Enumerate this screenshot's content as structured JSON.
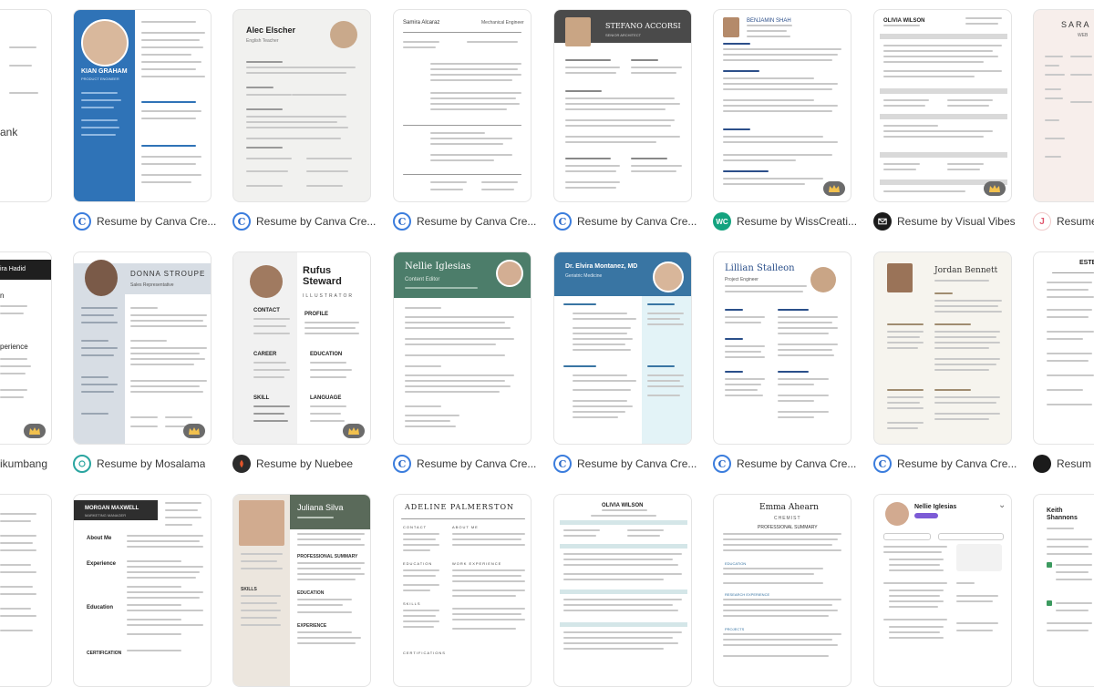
{
  "row1": {
    "cards": [
      {
        "name": "KIAN GRAHAM",
        "subtitle": "PRODUCT ENGINEER"
      },
      {
        "name": "Alec Elscher",
        "subtitle": "English Teacher"
      },
      {
        "name": "Samira Alcaraz",
        "subtitle": "Mechanical Engineer"
      },
      {
        "name": "STEFANO ACCORSI",
        "subtitle": "SENIOR ARCHITECT"
      },
      {
        "name": "BENJAMIN SHAH"
      },
      {
        "name": "OLIVIA WILSON"
      },
      {
        "name": "SARA",
        "subtitle": "WEB"
      }
    ],
    "captions": [
      {
        "text": "ank"
      },
      {
        "text": "Resume by Canva Cre..."
      },
      {
        "text": "Resume by Canva Cre..."
      },
      {
        "text": "Resume by Canva Cre..."
      },
      {
        "text": "Resume by Canva Cre..."
      },
      {
        "text": "Resume by WissCreati..."
      },
      {
        "text": "Resume by Visual Vibes"
      },
      {
        "text": "Resume"
      }
    ]
  },
  "row2": {
    "cards": [
      {
        "name": "ira Hadid",
        "section1": "n",
        "section2": "perience"
      },
      {
        "name": "DONNA STROUPE",
        "subtitle": "Sales Representative"
      },
      {
        "name": "Rufus Steward",
        "subtitle": "ILLUSTRATOR",
        "contact": "CONTACT",
        "profile": "PROFILE",
        "career": "CAREER",
        "education": "EDUCATION",
        "skill": "SKILL",
        "language": "LANGUAGE"
      },
      {
        "name": "Nellie Iglesias",
        "subtitle": "Content Editor"
      },
      {
        "name": "Dr. Elvira Montanez, MD",
        "subtitle": "Geriatric Medicine"
      },
      {
        "name": "Lillian Stalleon",
        "subtitle": "Project Engineer"
      },
      {
        "name": "Jordan Bennett"
      },
      {
        "name": "ESTE"
      }
    ],
    "captions": [
      {
        "text": "ikumbang"
      },
      {
        "text": "Resume by Mosalama"
      },
      {
        "text": "Resume by Nuebee"
      },
      {
        "text": "Resume by Canva Cre..."
      },
      {
        "text": "Resume by Canva Cre..."
      },
      {
        "text": "Resume by Canva Cre..."
      },
      {
        "text": "Resume by Canva Cre..."
      },
      {
        "text": "Resum"
      }
    ]
  },
  "row3": {
    "cards": [
      {
        "name": ""
      },
      {
        "name": "MORGAN MAXWELL",
        "subtitle": "MARKETING MANAGER",
        "about": "About Me",
        "experience": "Experience",
        "education": "Education",
        "certification": "CERTIFICATION"
      },
      {
        "name": "Juliana Silva",
        "summary": "PROFESSIONAL SUMMARY",
        "skills": "SKILLS",
        "education": "EDUCATION",
        "experience": "EXPERIENCE"
      },
      {
        "name": "ADELINE PALMERSTON",
        "contact": "CONTACT",
        "about": "ABOUT ME",
        "education": "EDUCATION",
        "work": "WORK EXPERIENCE",
        "skills": "SKILLS",
        "certifications": "CERTIFICATIONS"
      },
      {
        "name": "OLIVIA WILSON"
      },
      {
        "name": "Emma Ahearn",
        "subtitle": "CHEMIST",
        "summary": "PROFESSIONAL SUMMARY",
        "education": "EDUCATION",
        "research": "RESEARCH EXPERIENCE",
        "projects": "PROJECTS"
      },
      {
        "name": "Nellie Iglesias"
      },
      {
        "name": "Keith Shannons"
      }
    ]
  },
  "colors": {
    "canva_blue": "#3b7ddd",
    "crown_badge": "#6b6b6b",
    "kian_blue": "#2f73b7",
    "donna_grey": "#d7dde4",
    "nellie_green": "#4c7d6a",
    "elvira_blue": "#3975a3",
    "juliana_green": "#5a6a5a"
  },
  "icons": [
    "canva-logo-icon",
    "wisscreative-logo-icon",
    "visual-vibes-logo-icon",
    "mosalama-logo-icon",
    "nuebee-logo-icon",
    "crown-premium-icon"
  ]
}
